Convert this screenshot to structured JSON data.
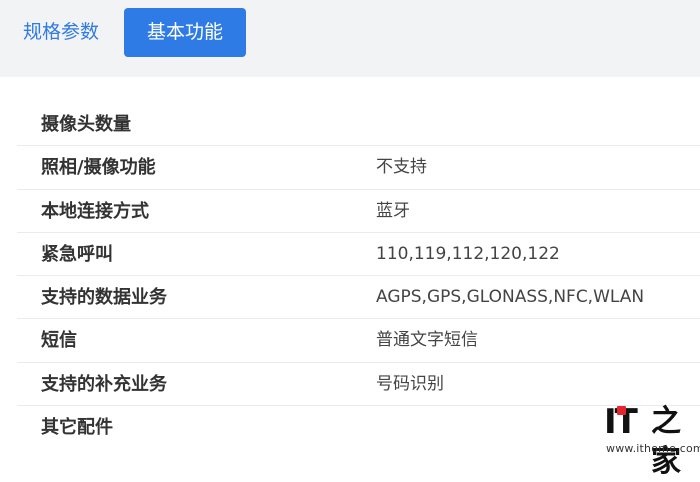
{
  "tabs": {
    "specs_label": "规格参数",
    "basic_label": "基本功能",
    "active": "基本功能"
  },
  "rows": [
    {
      "label": "摄像头数量",
      "value": ""
    },
    {
      "label": "照相/摄像功能",
      "value": "不支持"
    },
    {
      "label": "本地连接方式",
      "value": "蓝牙"
    },
    {
      "label": "紧急呼叫",
      "value": "110,119,112,120,122"
    },
    {
      "label": "支持的数据业务",
      "value": "AGPS,GPS,GLONASS,NFC,WLAN"
    },
    {
      "label": "短信",
      "value": "普通文字短信"
    },
    {
      "label": "支持的补充业务",
      "value": "号码识别"
    },
    {
      "label": "其它配件",
      "value": ""
    }
  ],
  "watermark": {
    "logo_text": "IT",
    "logo_char": "之家",
    "url": "www.ithome.com"
  },
  "colors": {
    "accent": "#2f7be5",
    "tabbar_bg": "#f2f3f5",
    "logo_red": "#e3262d"
  }
}
